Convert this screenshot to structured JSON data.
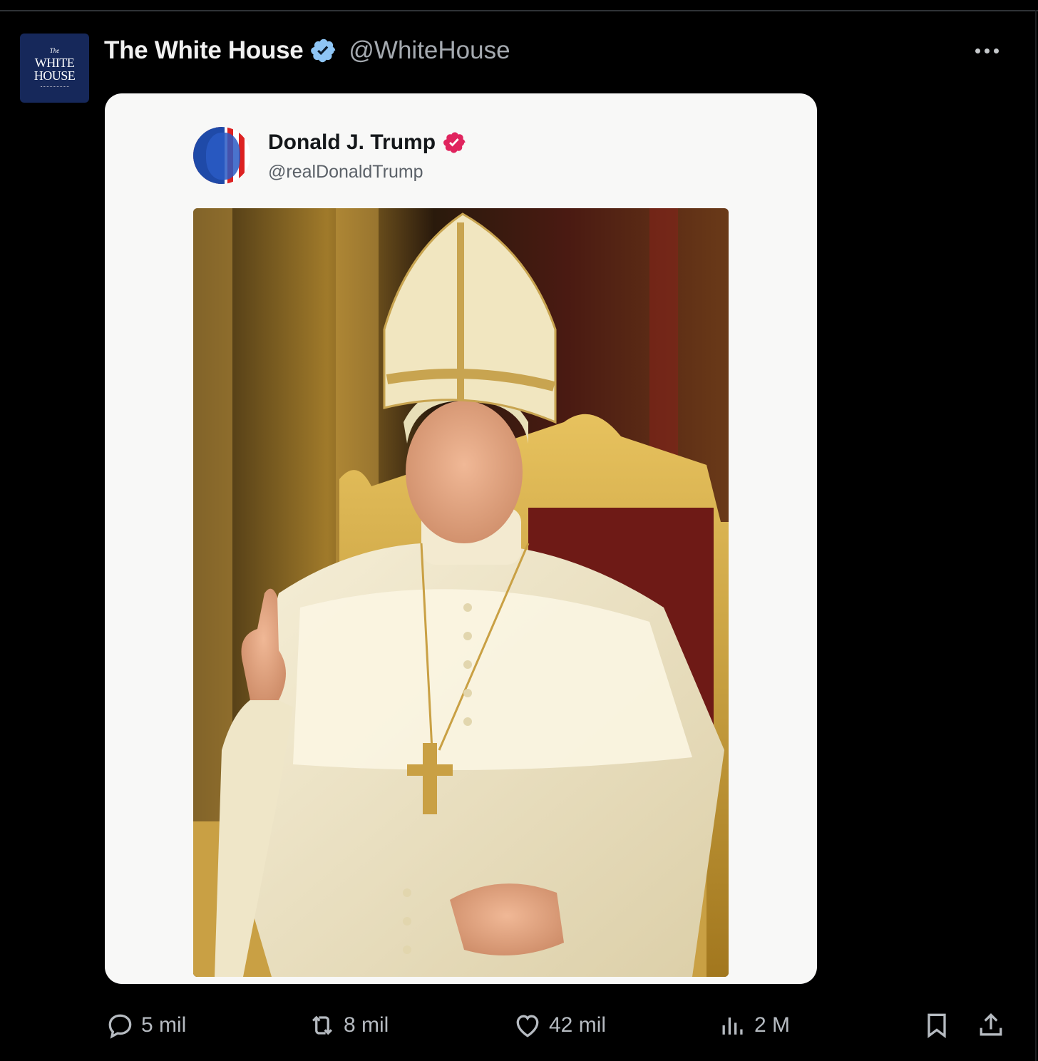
{
  "author": {
    "display_name": "The White House",
    "handle": "@WhiteHouse",
    "avatar_text": {
      "the": "The",
      "line1": "WHITE",
      "line2": "HOUSE"
    },
    "verified_color": "#8ec5f5"
  },
  "quoted_post": {
    "display_name": "Donald J. Trump",
    "handle": "@realDonaldTrump",
    "verified_color": "#e0245e"
  },
  "image": {
    "description_icon": "pope-portrait-image"
  },
  "actions": {
    "replies": "5 mil",
    "reposts": "8 mil",
    "likes": "42 mil",
    "views": "2 M"
  },
  "colors": {
    "background": "#000000",
    "card": "#f8f8f7",
    "muted": "#a5aab0"
  }
}
